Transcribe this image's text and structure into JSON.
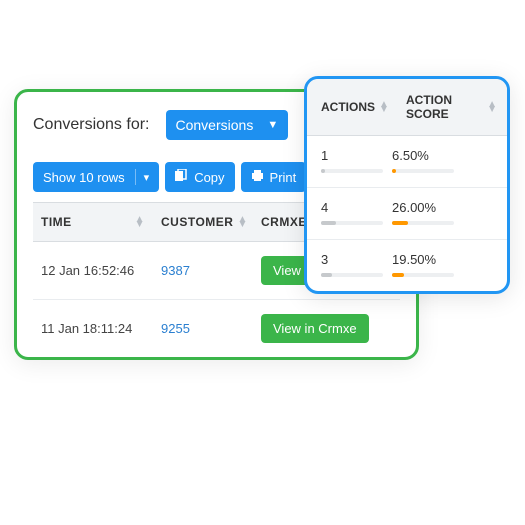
{
  "header": {
    "label": "Conversions for:",
    "dropdown": "Conversions"
  },
  "toolbar": {
    "rows_btn": "Show 10 rows",
    "copy": "Copy",
    "print": "Print"
  },
  "columns": {
    "time": "TIME",
    "customer": "CUSTOMER",
    "crmxe": "CRMXE"
  },
  "rows": [
    {
      "time": "12 Jan 16:52:46",
      "customer": "9387",
      "view": "View in Crmxe"
    },
    {
      "time": "11 Jan 18:11:24",
      "customer": "9255",
      "view": "View in Crmxe"
    }
  ],
  "side": {
    "columns": {
      "actions": "ACTIONS",
      "score": "ACTION SCORE"
    },
    "rows": [
      {
        "actions": "1",
        "actions_bar": 6,
        "score": "6.50%",
        "score_bar": 7
      },
      {
        "actions": "4",
        "actions_bar": 24,
        "score": "26.00%",
        "score_bar": 26
      },
      {
        "actions": "3",
        "actions_bar": 18,
        "score": "19.50%",
        "score_bar": 20
      }
    ]
  }
}
